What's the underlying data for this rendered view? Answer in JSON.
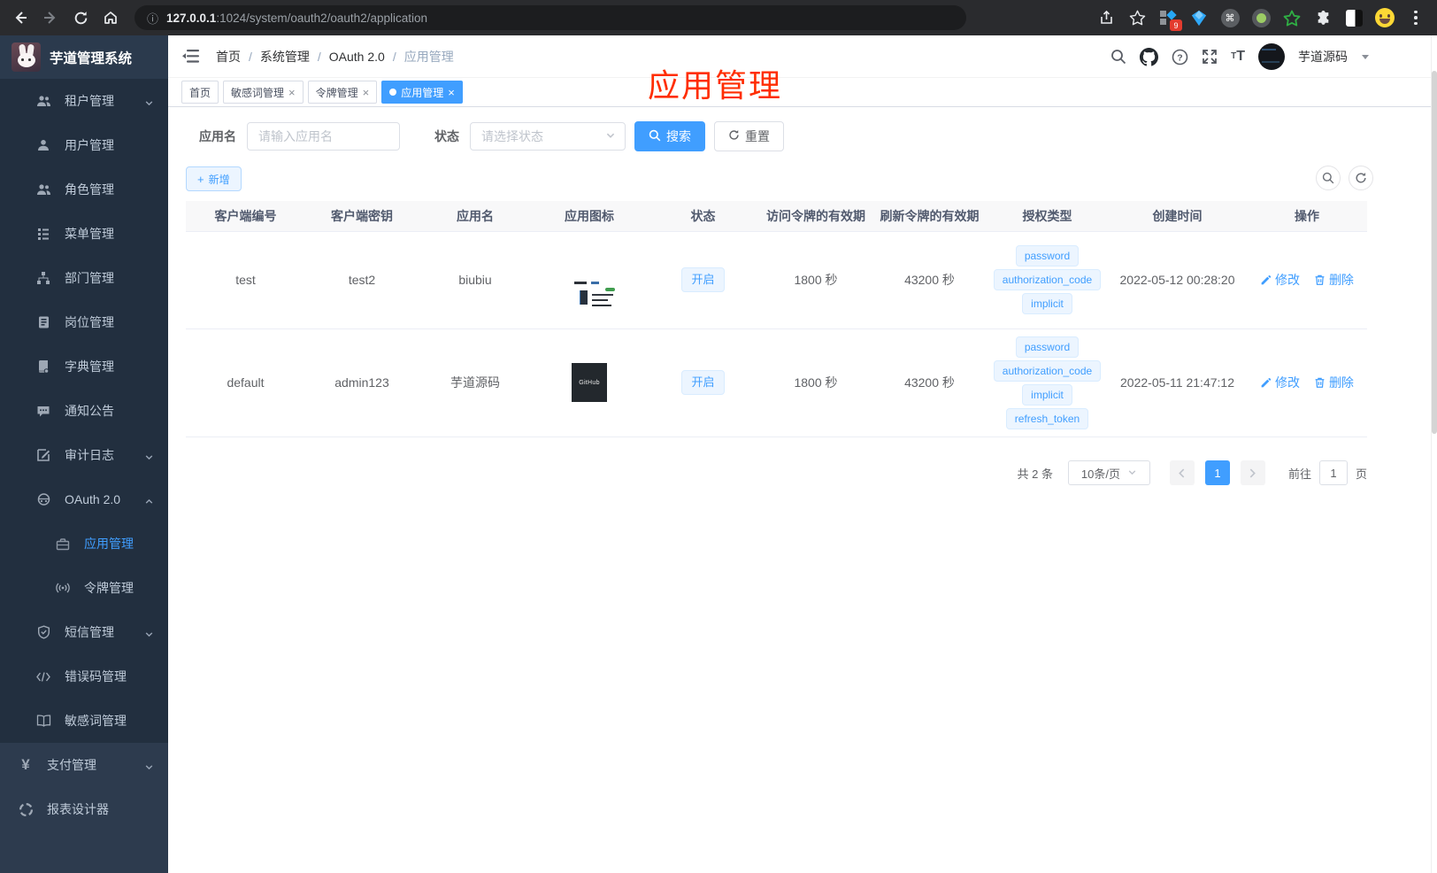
{
  "browser": {
    "url_host": "127.0.0.1",
    "url_rest": ":1024/system/oauth2/oauth2/application",
    "extension_badge": "9"
  },
  "colors": {
    "accent": "#409eff",
    "annotation_red": "#ff2d00",
    "sidebar_submenu_bg": "#222f3f",
    "sidebar_top_bg": "#2d3b4e",
    "tag_bg": "#ecf5ff",
    "table_header_bg": "#f8f8f9"
  },
  "sidebar": {
    "title": "芋道管理系统",
    "items": [
      {
        "label": "租户管理",
        "icon": "tenant-users-icon",
        "arrow": "down",
        "level": "sub",
        "active": false
      },
      {
        "label": "用户管理",
        "icon": "user-icon",
        "level": "sub",
        "active": false
      },
      {
        "label": "角色管理",
        "icon": "role-users-icon",
        "level": "sub",
        "active": false
      },
      {
        "label": "菜单管理",
        "icon": "menu-tree-icon",
        "level": "sub",
        "active": false
      },
      {
        "label": "部门管理",
        "icon": "dept-org-icon",
        "level": "sub",
        "active": false
      },
      {
        "label": "岗位管理",
        "icon": "post-badge-icon",
        "level": "sub",
        "active": false
      },
      {
        "label": "字典管理",
        "icon": "dict-book-icon",
        "level": "sub",
        "active": false
      },
      {
        "label": "通知公告",
        "icon": "notice-message-icon",
        "level": "sub",
        "active": false
      },
      {
        "label": "审计日志",
        "icon": "audit-log-icon",
        "arrow": "down",
        "level": "sub",
        "active": false
      },
      {
        "label": "OAuth 2.0",
        "icon": "oauth-robot-icon",
        "arrow": "up",
        "level": "sub",
        "active": false
      },
      {
        "label": "应用管理",
        "icon": "app-briefcase-icon",
        "level": "sub2",
        "active": true
      },
      {
        "label": "令牌管理",
        "icon": "token-signal-icon",
        "level": "sub2",
        "active": false
      },
      {
        "label": "短信管理",
        "icon": "sms-shield-icon",
        "arrow": "down",
        "level": "sub",
        "active": false
      },
      {
        "label": "错误码管理",
        "icon": "errorcode-icon",
        "level": "sub",
        "active": false
      },
      {
        "label": "敏感词管理",
        "icon": "sensitive-word-icon",
        "level": "sub",
        "active": false
      },
      {
        "label": "支付管理",
        "icon": "pay-yen-icon",
        "arrow": "down",
        "level": "top",
        "active": false
      },
      {
        "label": "报表设计器",
        "icon": "report-designer-icon",
        "level": "top",
        "active": false
      }
    ]
  },
  "navbar": {
    "breadcrumbs": [
      "首页",
      "系统管理",
      "OAuth 2.0",
      "应用管理"
    ],
    "separator": "/",
    "user_name": "芋道源码",
    "icons": [
      "search-icon",
      "github-icon",
      "help-icon",
      "fullscreen-icon",
      "font-size-icon"
    ]
  },
  "tags": {
    "items": [
      {
        "label": "首页",
        "closable": false,
        "active": false
      },
      {
        "label": "敏感词管理",
        "closable": true,
        "active": false
      },
      {
        "label": "令牌管理",
        "closable": true,
        "active": false
      },
      {
        "label": "应用管理",
        "closable": true,
        "active": true
      }
    ]
  },
  "annotation": {
    "text": "应用管理"
  },
  "filters": {
    "name_label": "应用名",
    "name_placeholder": "请输入应用名",
    "status_label": "状态",
    "status_placeholder": "请选择状态",
    "search_label": "搜索",
    "reset_label": "重置",
    "add_label": "新增"
  },
  "table": {
    "headers": [
      "客户端编号",
      "客户端密钥",
      "应用名",
      "应用图标",
      "状态",
      "访问令牌的有效期",
      "刷新令牌的有效期",
      "授权类型",
      "创建时间",
      "操作"
    ],
    "rows": [
      {
        "client_id": "test",
        "client_secret": "test2",
        "app_name": "biubiu",
        "icon": "dark-dashboard-screenshot",
        "status": "开启",
        "access_token_validity": "1800 秒",
        "refresh_token_validity": "43200 秒",
        "grants": [
          "password",
          "authorization_code",
          "implicit"
        ],
        "created_at": "2022-05-12 00:28:20",
        "edit_label": "修改",
        "delete_label": "删除"
      },
      {
        "client_id": "default",
        "client_secret": "admin123",
        "app_name": "芋道源码",
        "icon": "github-dark-logo",
        "icon_text": "GitHub",
        "status": "开启",
        "access_token_validity": "1800 秒",
        "refresh_token_validity": "43200 秒",
        "grants": [
          "password",
          "authorization_code",
          "implicit",
          "refresh_token"
        ],
        "created_at": "2022-05-11 21:47:12",
        "edit_label": "修改",
        "delete_label": "删除"
      }
    ]
  },
  "pagination": {
    "total": "共 2 条",
    "page_size": "10条/页",
    "current_page": "1",
    "goto_label": "前往",
    "goto_value": "1",
    "page_unit": "页"
  }
}
